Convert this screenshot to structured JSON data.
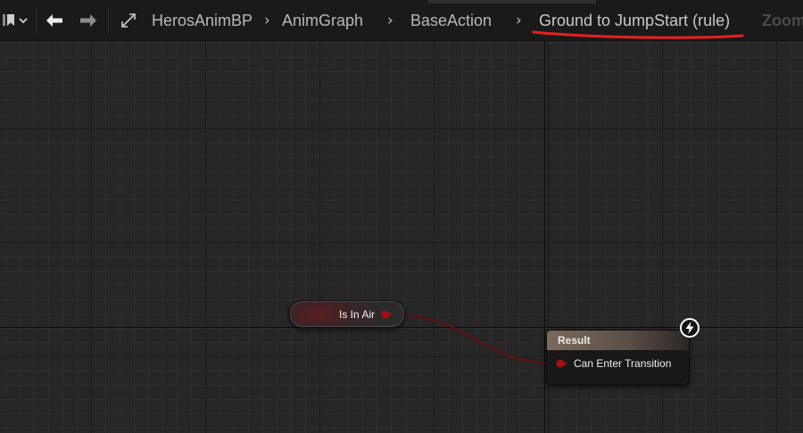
{
  "toolbar": {
    "breadcrumbs": [
      "HerosAnimBP",
      "AnimGraph",
      "BaseAction",
      "Ground to JumpStart (rule)"
    ],
    "zoom_label": "Zoom"
  },
  "graph": {
    "var_node": {
      "label": "Is In Air"
    },
    "result_node": {
      "title": "Result",
      "pin_label": "Can Enter Transition"
    }
  },
  "colors": {
    "bool_pin": "#a30f0f",
    "annotation_underline": "#e8211e"
  }
}
